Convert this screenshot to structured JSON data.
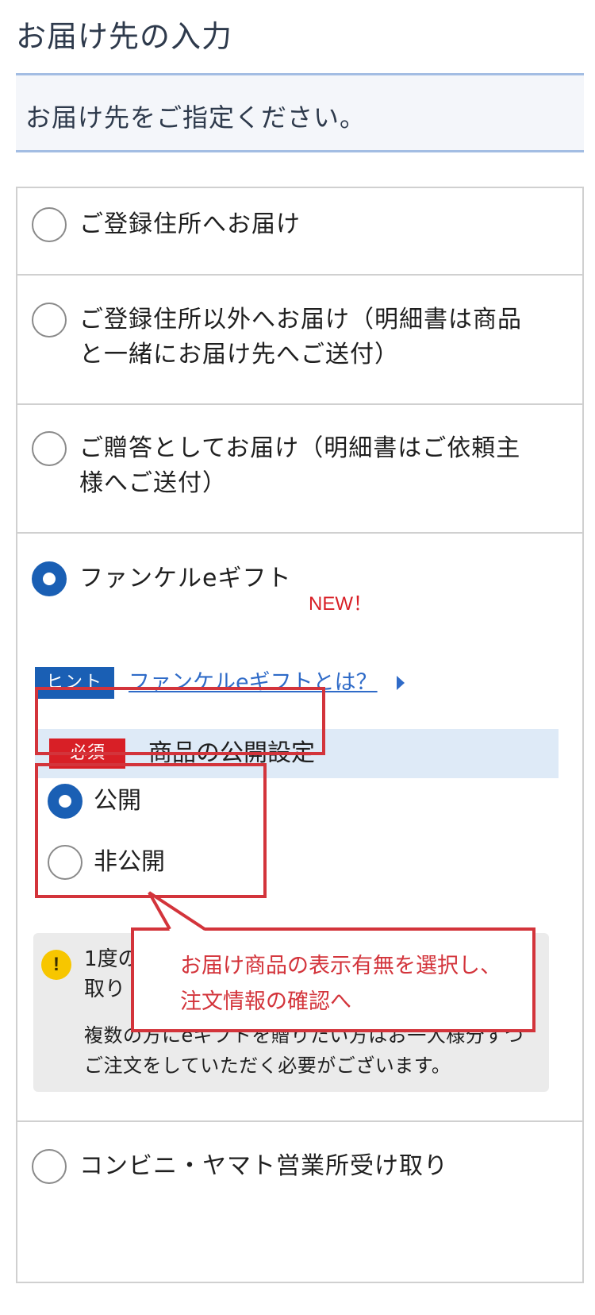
{
  "header": {
    "title": "お届け先の入力",
    "instruction": "お届け先をご指定ください。"
  },
  "options": [
    {
      "label": "ご登録住所へお届け",
      "selected": false
    },
    {
      "label_line1": "ご登録住所以外へお届け（明細書は商品",
      "label_line2": "と一緒にお届け先へご送付）",
      "selected": false
    },
    {
      "label_line1": "ご贈答としてお届け（明細書はご依頼主",
      "label_line2": "様へご送付）",
      "selected": false
    },
    {
      "label": "ファンケルeギフト",
      "badge": "NEW！",
      "selected": true
    },
    {
      "label": "コンビニ・ヤマト営業所受け取り",
      "selected": false
    }
  ],
  "egift": {
    "hint_badge": "ヒント",
    "hint_link": "ファンケルeギフトとは？",
    "required_badge": "必須",
    "publish_title": "商品の公開設定",
    "publish_options": [
      {
        "label": "公開",
        "selected": true
      },
      {
        "label": "非公開",
        "selected": false
      }
    ],
    "notice_line1": "1度の",
    "notice_line2": "取り",
    "notice_sub": "複数の方にeギフトを贈りたい方はお一人様分ずつご注文をしていただく必要がございます。"
  },
  "callout": {
    "line1": "お届け商品の表示有無を選択し、",
    "line2": "注文情報の確認へ"
  },
  "colors": {
    "accent_blue": "#1a5fb4",
    "link_blue": "#2f6bc8",
    "required_red": "#d81f26",
    "annotation_red": "#d3343b",
    "header_bg": "#deeaf7",
    "notice_bg": "#ebebeb",
    "warning_yellow": "#f7c600"
  },
  "icons": {
    "hint_arrow": "triangle-right-icon",
    "notice": "exclamation-circle-icon"
  }
}
